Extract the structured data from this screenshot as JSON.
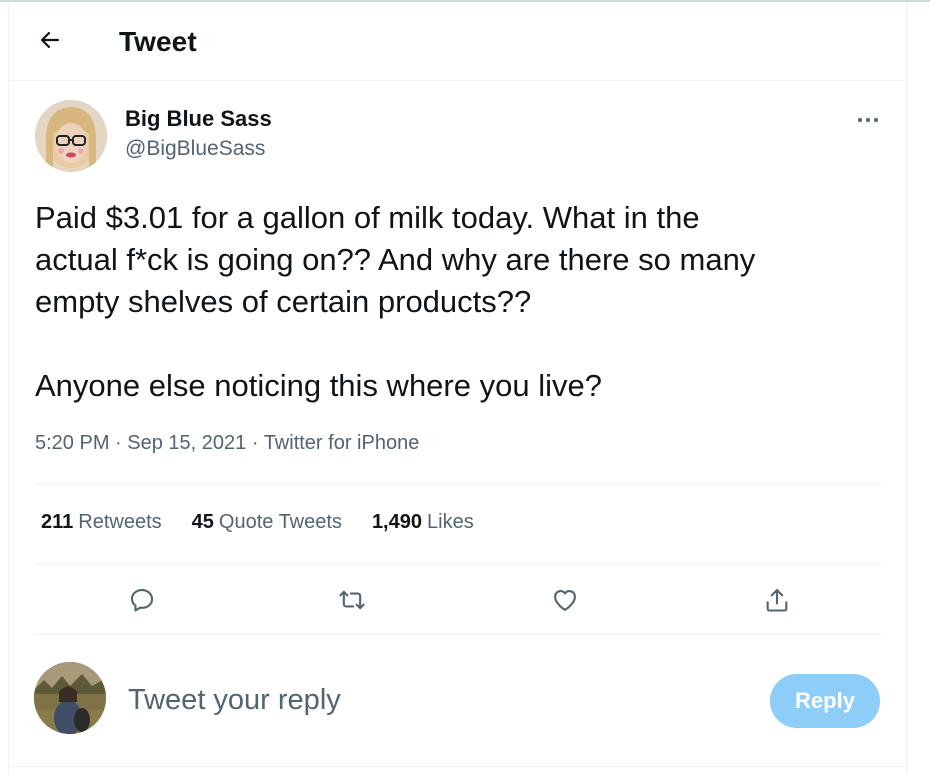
{
  "header": {
    "title": "Tweet"
  },
  "author": {
    "name": "Big Blue Sass",
    "handle": "@BigBlueSass"
  },
  "tweet": {
    "text": "Paid $3.01 for a gallon of milk today. What in the\nactual f*ck is going on?? And why are there so many\nempty shelves of certain products??\n\nAnyone else noticing this where you live?",
    "time": "5:20 PM",
    "date": "Sep 15, 2021",
    "source": "Twitter for iPhone"
  },
  "stats": {
    "retweets_count": "211",
    "retweets_label": "Retweets",
    "quotes_count": "45",
    "quotes_label": "Quote Tweets",
    "likes_count": "1,490",
    "likes_label": "Likes"
  },
  "reply": {
    "placeholder": "Tweet your reply",
    "button_label": "Reply"
  },
  "icons": {
    "back": "arrow-left-icon",
    "more": "more-dots-icon",
    "reply": "comment-icon",
    "retweet": "retweet-icon",
    "like": "heart-icon",
    "share": "share-icon"
  },
  "colors": {
    "secondary_text": "#536471",
    "reply_button": "#8ecdf8",
    "divider": "#eff3f4"
  }
}
